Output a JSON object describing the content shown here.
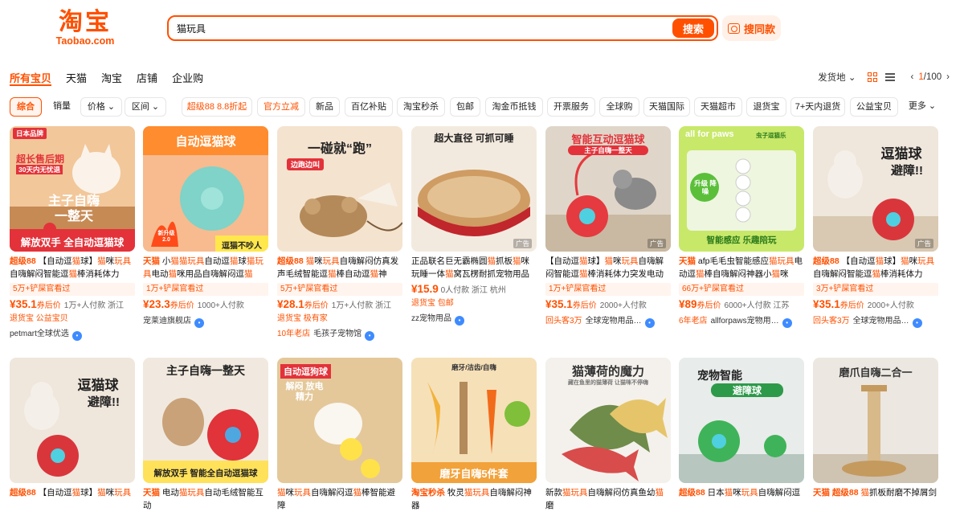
{
  "header": {
    "logo_cn": "淘宝",
    "logo_en": "Taobao.com",
    "search_value": "猫玩具",
    "search_button": "搜索",
    "same_button": "搜同款"
  },
  "tabs": [
    "所有宝贝",
    "天猫",
    "淘宝",
    "店铺",
    "企业购"
  ],
  "right_controls": {
    "ship_from": "发货地",
    "page_current": "1",
    "page_total": "/100"
  },
  "filters": [
    "综合",
    "销量",
    "价格",
    "区间",
    "超级88 8.8折起",
    "官方立减",
    "新品",
    "百亿补贴",
    "淘宝秒杀",
    "包邮",
    "淘金币抵钱",
    "开票服务",
    "全球购",
    "天猫国际",
    "天猫超市",
    "退货宝",
    "7+天内退货",
    "公益宝贝",
    "更多"
  ],
  "products_row1": [
    {
      "img_top": "超长售后期",
      "img_mid": "30天内无忧退",
      "img_main": "主子自嗨 一整天",
      "img_bottom": "解放双手 全自动逗猫球",
      "img_tag": "日本品牌",
      "brand": "超级88",
      "title": "【自动逗猫球】猫咪玩具自嗨解闷智能逗猫棒消耗体力突…",
      "coupon": "5万+铲屎官看过",
      "price": "¥35.1",
      "price_suffix": "券后价",
      "sales": "1万+人付款",
      "location": "浙江",
      "tags": "退货宝  公益宝贝",
      "shop": "petmart全球优选"
    },
    {
      "img_top": "自动逗猫球",
      "img_mid": "",
      "img_main": "逗猫不吵人",
      "img_bottom": "",
      "img_tag": "新升级 2.0",
      "brand": "天猫",
      "title": "小猫猫玩具自动逗猫球猫玩具电动猫咪用品自嗨解闷逗猫神…",
      "coupon": "1万+铲屎官看过",
      "price": "¥23.3",
      "price_suffix": "券后价",
      "sales": "1000+人付款",
      "location": "",
      "tags": "",
      "shop": "宠莱迪旗舰店"
    },
    {
      "img_top": "一碰就“跑”",
      "img_mid": "边跑边叫",
      "img_main": "",
      "img_bottom": "",
      "img_tag": "",
      "brand": "超级88",
      "title": "猫咪玩具自嗨解闷仿真发声毛绒智能逗猫棒自动逗猫神器…",
      "coupon": "5万+铲屎官看过",
      "price": "¥28.1",
      "price_suffix": "券后价",
      "sales": "1万+人付款",
      "location": "浙江",
      "tags": "退货宝  极有家",
      "shop": "毛孩子宠物馆",
      "shop_tag": "10年老店"
    },
    {
      "img_top": "超大直径 可抓可睡",
      "img_mid": "",
      "img_main": "",
      "img_bottom": "",
      "img_tag": "",
      "brand": "",
      "title": "正品联名巨无霸椭圆猫抓板猫咪玩睡一体猫窝瓦楞耐抓宠物用品",
      "coupon": "",
      "price": "¥15.9",
      "price_suffix": "",
      "sales": "0人付款",
      "location": "浙江 杭州",
      "tags": "退货宝  包邮",
      "shop": "zz宠物用品"
    },
    {
      "img_top": "智能互动逗猫球",
      "img_mid": "主子自嗨一整天",
      "img_main": "",
      "img_bottom": "",
      "img_tag": "",
      "brand": "",
      "title": "【自动逗猫球】猫咪玩具自嗨解闷智能逗猫棒消耗体力突发电动",
      "coupon": "1万+铲屎官看过",
      "price": "¥35.1",
      "price_suffix": "券后价",
      "sales": "2000+人付款",
      "location": "",
      "tags": "",
      "shop": "全球宠物用品…",
      "shop_tag": "回头客3万"
    },
    {
      "img_top": "all for paws",
      "img_mid": "虫子逗猫乐",
      "img_main": "升级 降噪",
      "img_bottom": "智能感应  乐趣陪玩",
      "img_tag": "",
      "brand": "天猫",
      "title": "afp毛毛虫智能感应猫玩具电动逗猫棒自嗨解闷神器小猫咪消…",
      "coupon": "66万+铲屎官看过",
      "price": "¥89",
      "price_suffix": "券后价",
      "sales": "6000+人付款",
      "location": "江苏",
      "tags": "",
      "shop": "allforpaws宠物用…",
      "shop_tag": "6年老店"
    },
    {
      "img_top": "逗猫球",
      "img_mid": "避障!!",
      "img_main": "",
      "img_bottom": "",
      "img_tag": "",
      "brand": "超级88",
      "title": "【自动逗猫球】猫咪玩具自嗨解闷智能逗猫棒消耗体力突…",
      "coupon": "3万+铲屎官看过",
      "price": "¥35.1",
      "price_suffix": "券后价",
      "sales": "2000+人付款",
      "location": "",
      "tags": "",
      "shop": "全球宠物用品…",
      "shop_tag": "回头客3万"
    }
  ],
  "products_row2": [
    {
      "img_top": "逗猫球",
      "img_mid": "避障!!",
      "brand": "超级88",
      "title": "【自动逗猫球】猫咪玩具"
    },
    {
      "img_top": "主子自嗨一整天",
      "img_mid": "解放双手  智能全自动逗猫球",
      "brand": "天猫",
      "title": "电动猫玩具自动毛绒智能互动"
    },
    {
      "img_top": "自动逗狗球",
      "img_mid": "解闷 放电精力",
      "brand": "",
      "title": "猫咪玩具自嗨解闷逗猫棒智能避障"
    },
    {
      "img_top": "磨牙/洁齿/自嗨",
      "img_mid": "磨牙自嗨5件套",
      "brand": "淘宝秒杀",
      "title": "牧灵猫玩具自嗨解闷神器"
    },
    {
      "img_top": "猫薄荷的魔力",
      "img_mid": "藏在鱼里的猫薄荷 让猫咪不停嗨",
      "brand": "",
      "title": "新款猫玩具自嗨解闷仿真鱼幼猫磨"
    },
    {
      "img_top": "宠物智能",
      "img_mid": "避障球",
      "brand": "超级88",
      "title": "日本猫咪玩具自嗨解闷逗"
    },
    {
      "img_top": "磨爪自嗨二合一",
      "img_mid": "",
      "brand": "天猫 超级88",
      "title": "猫抓板耐磨不掉屑剑"
    }
  ],
  "ad_label": "广告",
  "colors": {
    "accent": "#ff5000",
    "coupon_bg": "#fff4ee"
  }
}
